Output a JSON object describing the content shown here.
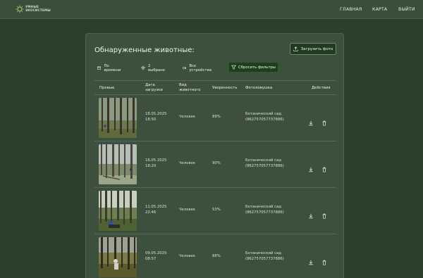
{
  "header": {
    "logo_line1": "УМНЫЕ",
    "logo_line2": "ЭКОСИСТЕМЫ",
    "nav": [
      "ГЛАВНАЯ",
      "КАРТА",
      "ВЫЙТИ"
    ]
  },
  "panel": {
    "title": "Обнаруженные животные:",
    "upload_label": "Загрузить фото"
  },
  "filters": {
    "time": "По времени",
    "selected": "2 выбрано",
    "devices": "Все устройства",
    "reset": "Сбросить фильтры"
  },
  "table": {
    "columns": [
      "Превью",
      "Дата загрузки",
      "Вид животного",
      "Уверенность",
      "Фотоловушка",
      "Действия"
    ],
    "rows": [
      {
        "date": "18.05.2025",
        "time": "18:50",
        "species": "Человек",
        "confidence": "89%",
        "trap_name": "Ботанический сад",
        "trap_id": "(862757057737886)"
      },
      {
        "date": "16.05.2025",
        "time": "18:20",
        "species": "Человек",
        "confidence": "90%",
        "trap_name": "Ботанический сад",
        "trap_id": "(862757057737886)"
      },
      {
        "date": "11.05.2025",
        "time": "22:46",
        "species": "Человек",
        "confidence": "53%",
        "trap_name": "Ботанический сад",
        "trap_id": "(862757057737886)"
      },
      {
        "date": "09.05.2025",
        "time": "08:57",
        "species": "Человек",
        "confidence": "88%",
        "trap_name": "Ботанический сад",
        "trap_id": "(862757057737886)"
      }
    ]
  },
  "colors": {
    "background": "#2d3e2d",
    "panel": "#3d4f3d",
    "accent_button": "#1f3d1f"
  },
  "icons": [
    "calendar-icon",
    "paw-icon",
    "camera-icon",
    "filter-icon",
    "upload-icon",
    "download-icon",
    "trash-icon"
  ]
}
